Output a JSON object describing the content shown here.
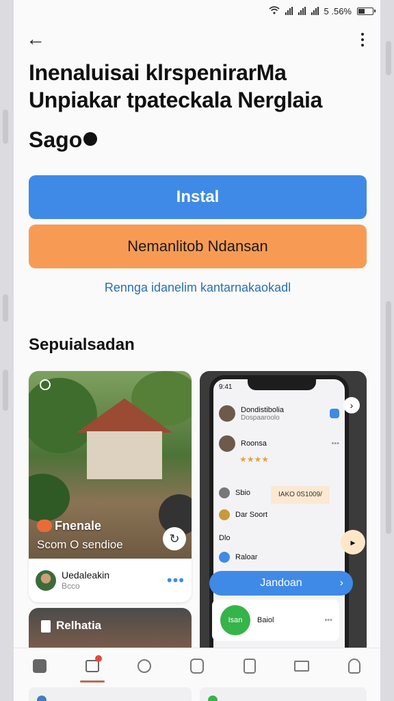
{
  "status_bar": {
    "battery_text": "5 .56%"
  },
  "header": {
    "back_icon": "arrow-left-icon",
    "menu_icon": "more-vertical-icon"
  },
  "app": {
    "title": "Inenaluisai klrspenirarMa Unpiakar tpateckala Nerglaia",
    "subtitle": "Sago"
  },
  "actions": {
    "install_label": "Instal",
    "secondary_label": "Nemanlitob Ndansan",
    "link_text": "Rennga idanelim kantarnakaokadl"
  },
  "screenshots_section": {
    "title": "Sepuialsadan",
    "card1": {
      "caption": "Fnenale",
      "meta": "Scom O sendioe",
      "author": "Uedaleakin",
      "author_sub": "Bcco"
    },
    "card2": {
      "status_time": "9:41",
      "row1_title": "Dondistibolia",
      "row1_sub": "Dospaaroolo",
      "row2_title": "Roonsa",
      "stars": "★★★★",
      "tag": "IAKO 0S1009/",
      "row3": "Sbio",
      "row4": "Dar Soort",
      "row5": "Dlo",
      "row6": "Raloar",
      "button_label": "Jandoan",
      "green_label": "Isan",
      "green_side": "Baiol"
    },
    "card3": {
      "caption": "Relhatia"
    }
  },
  "bottom_nav": {
    "items": [
      "apps-icon",
      "home-icon",
      "search-icon",
      "bag-icon",
      "bus-icon",
      "mail-icon",
      "profile-icon"
    ],
    "active_index": 1
  },
  "colors": {
    "primary": "#3f8ae6",
    "secondary": "#f79b54",
    "link": "#2a6fb3"
  }
}
